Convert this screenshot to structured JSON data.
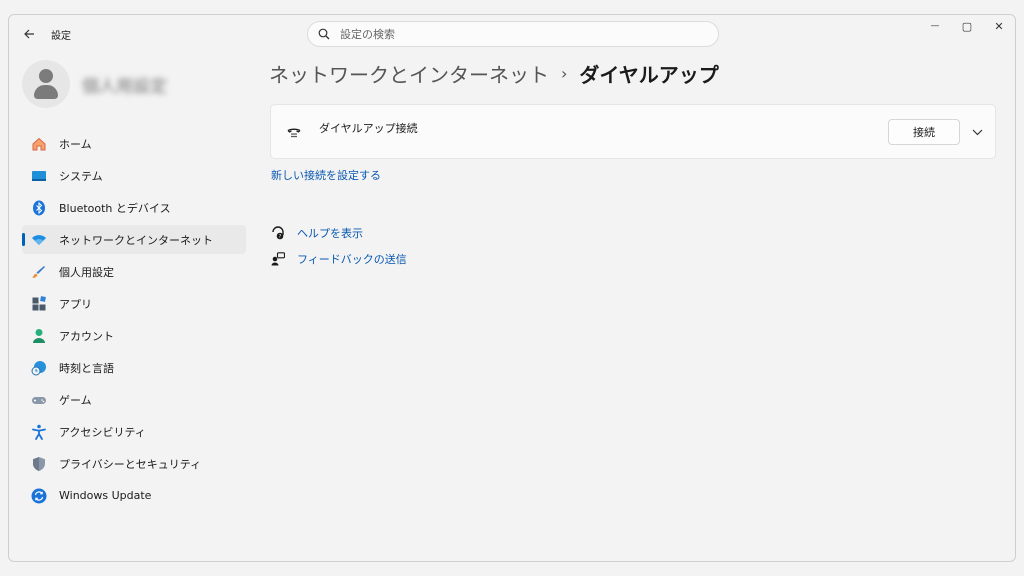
{
  "window": {
    "title": "設定",
    "back_icon": "back-arrow-icon",
    "controls": {
      "minimize": "—",
      "maximize": "▢",
      "close": "✕"
    }
  },
  "search": {
    "placeholder": "設定の検索",
    "value": ""
  },
  "profile": {
    "name": "個人用設定"
  },
  "nav": {
    "items": [
      {
        "label": "ホーム",
        "icon": "home-icon"
      },
      {
        "label": "システム",
        "icon": "display-icon"
      },
      {
        "label": "Bluetooth とデバイス",
        "icon": "bluetooth-icon"
      },
      {
        "label": "ネットワークとインターネット",
        "icon": "wifi-icon",
        "active": true
      },
      {
        "label": "個人用設定",
        "icon": "brush-icon"
      },
      {
        "label": "アプリ",
        "icon": "apps-icon"
      },
      {
        "label": "アカウント",
        "icon": "account-icon"
      },
      {
        "label": "時刻と言語",
        "icon": "globe-clock-icon"
      },
      {
        "label": "ゲーム",
        "icon": "gamepad-icon"
      },
      {
        "label": "アクセシビリティ",
        "icon": "accessibility-icon"
      },
      {
        "label": "プライバシーとセキュリティ",
        "icon": "shield-icon"
      },
      {
        "label": "Windows Update",
        "icon": "update-icon"
      }
    ]
  },
  "breadcrumb": {
    "parent": "ネットワークとインターネット",
    "separator": "›",
    "current": "ダイヤルアップ"
  },
  "dialup": {
    "connection_label": "ダイヤルアップ接続",
    "connect_button": "接続"
  },
  "links": {
    "new_connection": "新しい接続を設定する",
    "help": "ヘルプを表示",
    "feedback": "フィードバックの送信"
  },
  "colors": {
    "accent": "#005fb8",
    "link": "#0a58b0",
    "background": "#f3f3f3"
  }
}
